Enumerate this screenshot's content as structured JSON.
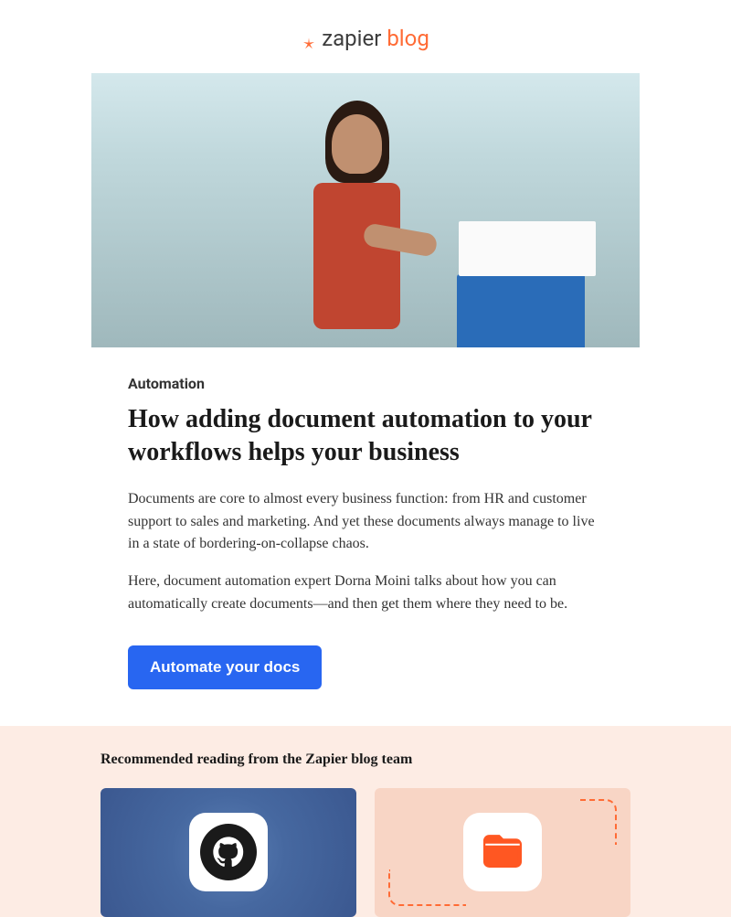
{
  "logo": {
    "brand": "zapier",
    "sub": "blog"
  },
  "article": {
    "category": "Automation",
    "title": "How adding document automation to your workflows helps your business",
    "paragraph1": "Documents are core to almost every business function: from HR and customer support to sales and marketing. And yet these documents always manage to live in a state of bordering-on-collapse chaos.",
    "paragraph2": "Here, document automation expert Dorna Moini talks about how you can automatically create documents—and then get them where they need to be.",
    "cta_label": "Automate your docs"
  },
  "recommended": {
    "title": "Recommended reading from the Zapier blog team"
  }
}
